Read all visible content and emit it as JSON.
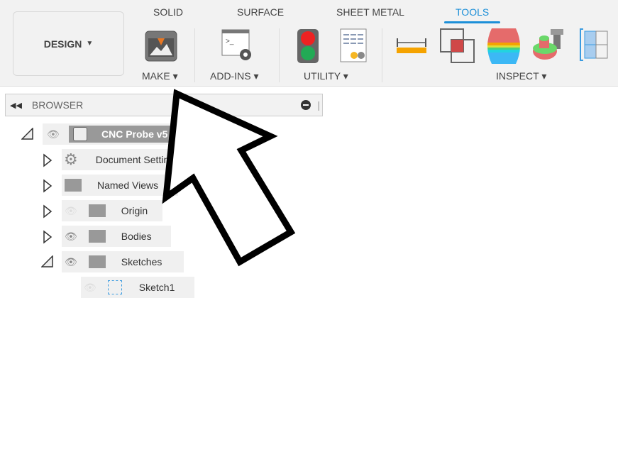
{
  "tabs": [
    {
      "label": "SOLID"
    },
    {
      "label": "SURFACE"
    },
    {
      "label": "SHEET METAL"
    },
    {
      "label": "TOOLS",
      "active": true
    }
  ],
  "workspace": {
    "label": "DESIGN"
  },
  "groups": {
    "make": "MAKE",
    "addins": "ADD-INS",
    "utility": "UTILITY",
    "inspect": "INSPECT"
  },
  "browser": {
    "title": "BROWSER",
    "root": {
      "label": "CNC Probe v5"
    },
    "items": [
      {
        "label": "Document Settings"
      },
      {
        "label": "Named Views"
      },
      {
        "label": "Origin"
      },
      {
        "label": "Bodies"
      },
      {
        "label": "Sketches"
      },
      {
        "label": "Sketch1"
      }
    ]
  },
  "colors": {
    "accent": "#1c8fd8"
  }
}
